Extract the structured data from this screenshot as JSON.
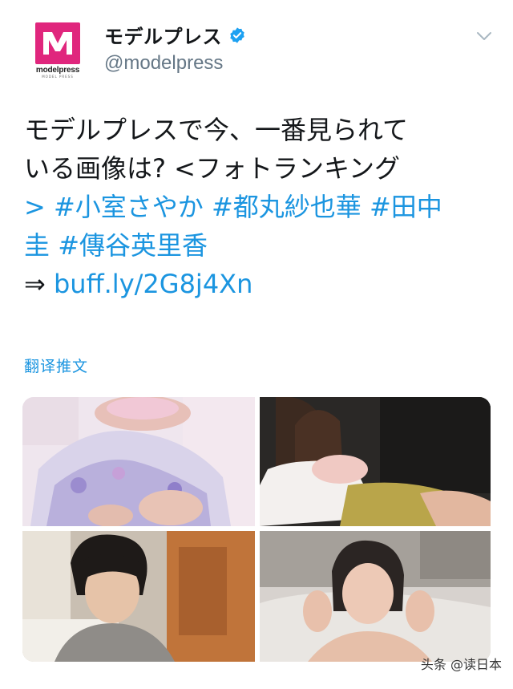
{
  "account": {
    "display_name": "モデルプレス",
    "handle": "@modelpress",
    "avatar_word": "modelpress",
    "avatar_sub": "MODEL PRESS",
    "verified": true,
    "avatar_color": "#e0267d"
  },
  "tweet": {
    "line1": "モデルプレスで今、一番見られて",
    "line2": "いる画像は?  <フォトランキング",
    "line3_prefix": "> ",
    "hashtags": [
      "#小室さやか",
      "#都丸紗也華",
      "#田中圭",
      "#傳谷英里香"
    ],
    "arrow": "⇒ ",
    "link": "buff.ly/2G8j4Xn"
  },
  "translate_label": "翻译推文",
  "media": {
    "tiles": [
      {
        "name": "photo-1"
      },
      {
        "name": "photo-2"
      },
      {
        "name": "photo-3"
      },
      {
        "name": "photo-4"
      }
    ]
  },
  "watermark": "头条 @读日本",
  "colors": {
    "link": "#1b95e0",
    "text": "#14171a",
    "secondary": "#657786"
  }
}
